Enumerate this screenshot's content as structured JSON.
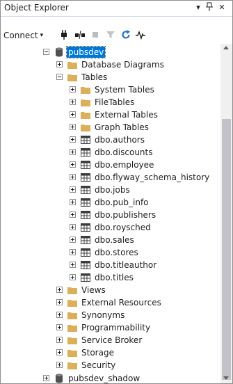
{
  "title_bar": {
    "title": "Object Explorer",
    "dropdown_glyph": "▾",
    "pin_glyph": "📌",
    "close_glyph": "✕"
  },
  "toolbar": {
    "connect_label": "Connect",
    "dropdown_glyph": "▾",
    "icons": [
      "connect-object-explorer-icon",
      "disconnect-icon",
      "stop-icon",
      "filter-icon",
      "refresh-icon",
      "activity-monitor-icon"
    ]
  },
  "tree": {
    "database": "pubsdev",
    "items": {
      "database_diagrams": "Database Diagrams",
      "tables": "Tables",
      "system_tables": "System Tables",
      "file_tables": "FileTables",
      "external_tables": "External Tables",
      "graph_tables": "Graph Tables",
      "t_authors": "dbo.authors",
      "t_discounts": "dbo.discounts",
      "t_employee": "dbo.employee",
      "t_flyway": "dbo.flyway_schema_history",
      "t_jobs": "dbo.jobs",
      "t_pub_info": "dbo.pub_info",
      "t_publishers": "dbo.publishers",
      "t_roysched": "dbo.roysched",
      "t_sales": "dbo.sales",
      "t_stores": "dbo.stores",
      "t_titleauthor": "dbo.titleauthor",
      "t_titles": "dbo.titles",
      "views": "Views",
      "external_resources": "External Resources",
      "synonyms": "Synonyms",
      "programmability": "Programmability",
      "service_broker": "Service Broker",
      "storage": "Storage",
      "security": "Security"
    },
    "next_database": "pubsdev_shadow"
  },
  "colors": {
    "selection": "#0078d7",
    "folder": "#dcb05a",
    "refresh": "#1e74c7"
  }
}
